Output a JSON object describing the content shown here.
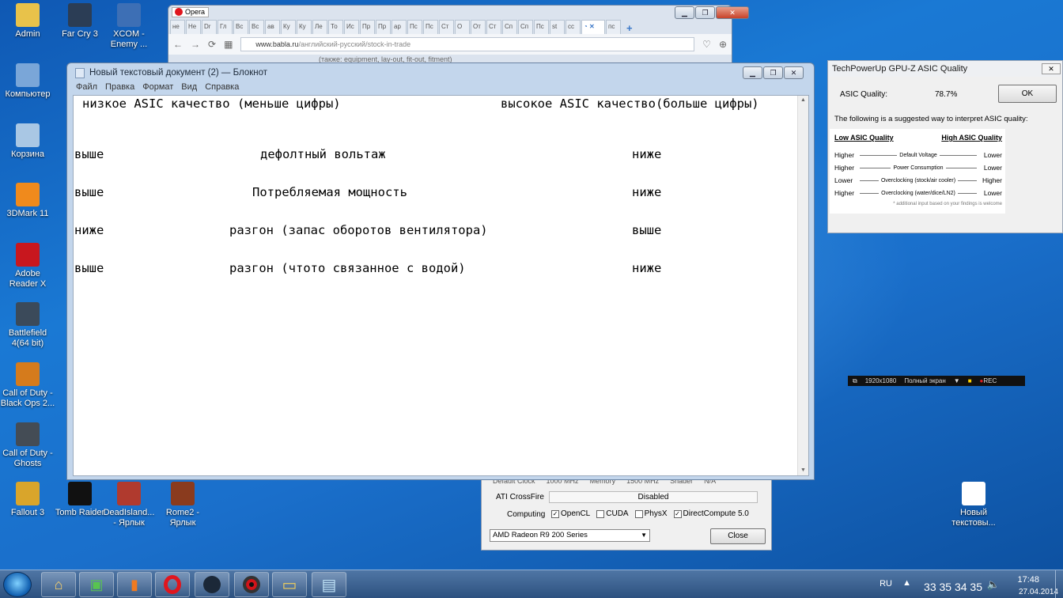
{
  "desktop": {
    "icons": [
      {
        "label": "Admin",
        "color": "#e8c24a"
      },
      {
        "label": "Far Cry 3",
        "color": "#2b3d55"
      },
      {
        "label": "XCOM -\nEnemy ...",
        "color": "#3d6fb5"
      },
      {
        "label": "Компьютер",
        "color": "#7aa6d8"
      },
      {
        "label": "Корзина",
        "color": "#a9c7e4"
      },
      {
        "label": "3DMark 11",
        "color": "#f08a1c"
      },
      {
        "label": "Adobe\nReader X",
        "color": "#c8171e"
      },
      {
        "label": "Battlefield\n4(64 bit)",
        "color": "#3b4a5a"
      },
      {
        "label": "Call of Duty -\nBlack Ops 2...",
        "color": "#d57b1c"
      },
      {
        "label": "Call of Duty -\nGhosts",
        "color": "#444c55"
      },
      {
        "label": "Fallout 3",
        "color": "#d9a52b"
      },
      {
        "label": "Tomb Raider",
        "color": "#111111"
      },
      {
        "label": "DeadIsland...\n- Ярлык",
        "color": "#b03a2e"
      },
      {
        "label": "Rome2 -\nЯрлык",
        "color": "#8a3b1e"
      },
      {
        "label": "Новый\nтекстовы...",
        "color": "#ffffff"
      }
    ]
  },
  "opera": {
    "app_label": "Opera",
    "tabs": [
      "не",
      "Не",
      "Dr",
      "Гл",
      "Вс",
      "Вс",
      "ав",
      "Ку",
      "Ку",
      "Ле",
      "То",
      "Ис",
      "Пр",
      "Пр",
      "ар",
      "Пс",
      "Пс",
      "Ст",
      "О",
      "От",
      "Ст",
      "Сп",
      "Сп",
      "Пс",
      "st",
      "сс",
      "",
      "пс"
    ],
    "url_domain": "www.babla.ru",
    "url_path": "/английский-русский/stock-in-trade",
    "page_snippet": "(также: equipment, lay-out, fit-out, fitment)"
  },
  "notepad": {
    "title": "Новый текстовый документ (2) — Блокнот",
    "menu": [
      "Файл",
      "Правка",
      "Формат",
      "Вид",
      "Справка"
    ],
    "lines": {
      "header_left": "низкое ASIC качество (меньше цифры)",
      "header_right": "высокое ASIC качество(больше цифры)",
      "rows": [
        {
          "left": "выше",
          "mid": "дефолтный вольтаж",
          "right": "ниже"
        },
        {
          "left": "выше",
          "mid": "Потребляемая мощность",
          "right": "ниже"
        },
        {
          "left": "ниже",
          "mid": "разгон (запас оборотов вентилятора)",
          "right": "выше"
        },
        {
          "left": "выше",
          "mid": "разгон (чтото связанное с водой)",
          "right": "ниже"
        }
      ]
    }
  },
  "gpuz_main": {
    "partial_row": [
      "Default Clock",
      "1000 MHz",
      "Memory",
      "1500 MHz",
      "Shader",
      "N/A"
    ],
    "crossfire_label": "ATI CrossFire",
    "crossfire_value": "Disabled",
    "computing_label": "Computing",
    "computing_opts": [
      {
        "label": "OpenCL",
        "checked": true
      },
      {
        "label": "CUDA",
        "checked": false
      },
      {
        "label": "PhysX",
        "checked": false
      },
      {
        "label": "DirectCompute 5.0",
        "checked": true
      }
    ],
    "gpu_select": "AMD Radeon R9 200 Series",
    "close_label": "Close"
  },
  "asic_dialog": {
    "title": "TechPowerUp GPU-Z ASIC Quality",
    "quality_label": "ASIC Quality:",
    "quality_value": "78.7%",
    "ok_label": "OK",
    "intro": "The following is a suggested way to interpret ASIC quality:",
    "low_header": "Low ASIC Quality",
    "high_header": "High ASIC Quality",
    "rows": [
      {
        "low": "Higher",
        "mid": "Default Voltage",
        "high": "Lower"
      },
      {
        "low": "Higher",
        "mid": "Power Consumption",
        "high": "Lower"
      },
      {
        "low": "Lower",
        "mid": "Overclocking (stock/air cooler)",
        "high": "Higher"
      },
      {
        "low": "Higher",
        "mid": "Overclocking (water/dice/LN2)",
        "high": "Lower"
      }
    ],
    "footnote": "* additional input based on your findings is welcome"
  },
  "recorder": {
    "resolution": "1920x1080",
    "mode": "Полный экран",
    "rec_label": "REC"
  },
  "taskbar": {
    "lang": "RU",
    "temps": "33 35 34 35",
    "time": "17:48",
    "date": "27.04.2014"
  }
}
